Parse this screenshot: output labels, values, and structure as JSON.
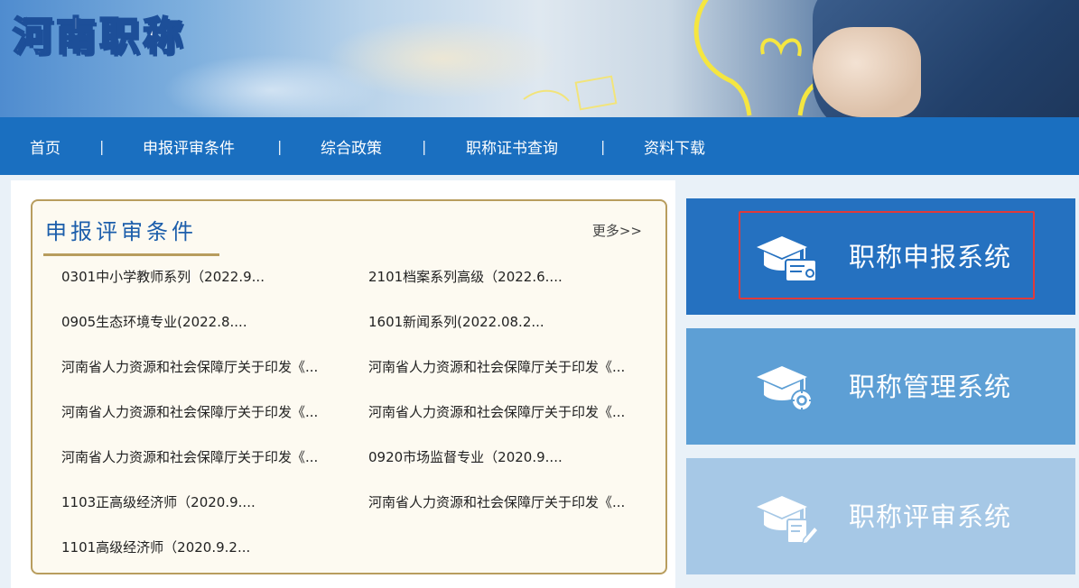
{
  "header": {
    "site_title": "河南职称"
  },
  "nav": {
    "items": [
      {
        "label": "首页"
      },
      {
        "label": "申报评审条件"
      },
      {
        "label": "综合政策"
      },
      {
        "label": "职称证书查询"
      },
      {
        "label": "资料下载"
      }
    ],
    "separator": "|"
  },
  "conditions_panel": {
    "title": "申报评审条件",
    "more_label": "更多>>",
    "items": [
      "0301中小学教师系列（2022.9...",
      "2101档案系列高级（2022.6....",
      "0905生态环境专业(2022.8....",
      "1601新闻系列(2022.08.2...",
      "河南省人力资源和社会保障厅关于印发《...",
      "河南省人力资源和社会保障厅关于印发《...",
      "河南省人力资源和社会保障厅关于印发《...",
      "河南省人力资源和社会保障厅关于印发《...",
      "河南省人力资源和社会保障厅关于印发《...",
      "0920市场监督专业（2020.9....",
      "1103正高级经济师（2020.9....",
      "河南省人力资源和社会保障厅关于印发《...",
      "1101高级经济师（2020.9.2..."
    ]
  },
  "systems": [
    {
      "label": "职称申报系统",
      "icon": "graduation-cap-certificate-icon",
      "color": "#2571c0",
      "highlighted": true
    },
    {
      "label": "职称管理系统",
      "icon": "graduation-cap-gear-icon",
      "color": "#5d9fd5",
      "highlighted": false
    },
    {
      "label": "职称评审系统",
      "icon": "graduation-cap-edit-icon",
      "color": "#a6c8e6",
      "highlighted": false
    }
  ],
  "colors": {
    "nav_bg": "#1a6fc0",
    "panel_border": "#b89d5e",
    "panel_title": "#1c5eab",
    "highlight_border": "#e03a3a"
  }
}
